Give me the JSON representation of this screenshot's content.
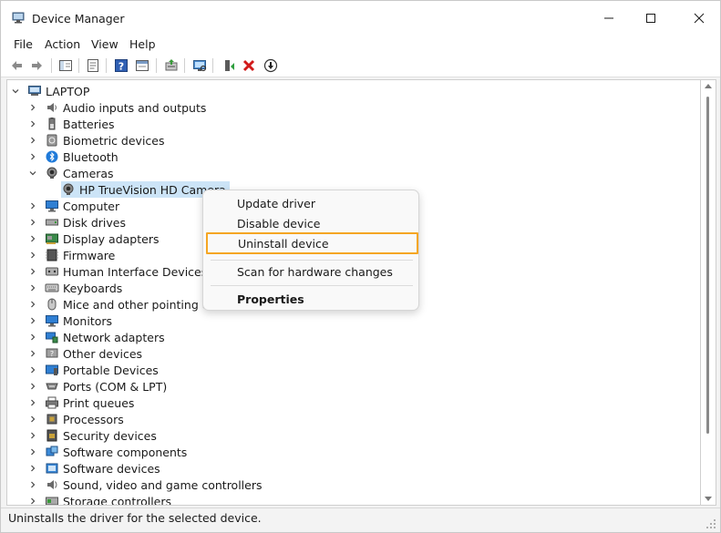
{
  "window": {
    "title": "Device Manager",
    "controls": {
      "minimize": "minimize-icon",
      "maximize": "maximize-icon",
      "close": "close-icon"
    }
  },
  "menubar": {
    "items": [
      "File",
      "Action",
      "View",
      "Help"
    ]
  },
  "toolbar": {
    "icons": [
      "back-arrow-icon",
      "forward-arrow-icon",
      "show-hide-tree-icon",
      "properties-icon",
      "help-icon",
      "view-resources-icon",
      "update-driver-icon",
      "scan-hardware-icon",
      "enable-device-icon",
      "uninstall-device-icon",
      "disable-device-icon"
    ]
  },
  "tree": {
    "root": "LAPTOP",
    "categories": [
      {
        "label": "Audio inputs and outputs",
        "icon": "speaker-icon"
      },
      {
        "label": "Batteries",
        "icon": "battery-icon"
      },
      {
        "label": "Biometric devices",
        "icon": "biometric-icon"
      },
      {
        "label": "Bluetooth",
        "icon": "bluetooth-icon"
      },
      {
        "label": "Cameras",
        "icon": "camera-icon",
        "expanded": true,
        "children": [
          {
            "label": "HP TrueVision HD Camera",
            "icon": "camera-icon",
            "selected": true
          }
        ]
      },
      {
        "label": "Computer",
        "icon": "monitor-icon"
      },
      {
        "label": "Disk drives",
        "icon": "disk-drive-icon"
      },
      {
        "label": "Display adapters",
        "icon": "display-adapter-icon"
      },
      {
        "label": "Firmware",
        "icon": "firmware-icon"
      },
      {
        "label": "Human Interface Devices",
        "icon": "hid-icon"
      },
      {
        "label": "Keyboards",
        "icon": "keyboard-icon"
      },
      {
        "label": "Mice and other pointing dev",
        "icon": "mouse-icon"
      },
      {
        "label": "Monitors",
        "icon": "monitor-icon"
      },
      {
        "label": "Network adapters",
        "icon": "network-adapter-icon"
      },
      {
        "label": "Other devices",
        "icon": "other-devices-icon"
      },
      {
        "label": "Portable Devices",
        "icon": "portable-device-icon"
      },
      {
        "label": "Ports (COM & LPT)",
        "icon": "port-icon"
      },
      {
        "label": "Print queues",
        "icon": "printer-icon"
      },
      {
        "label": "Processors",
        "icon": "processor-icon"
      },
      {
        "label": "Security devices",
        "icon": "security-device-icon"
      },
      {
        "label": "Software components",
        "icon": "software-component-icon"
      },
      {
        "label": "Software devices",
        "icon": "software-device-icon"
      },
      {
        "label": "Sound, video and game controllers",
        "icon": "sound-icon"
      },
      {
        "label": "Storage controllers",
        "icon": "storage-controller-icon"
      }
    ]
  },
  "context_menu": {
    "items": [
      {
        "label": "Update driver"
      },
      {
        "label": "Disable device"
      },
      {
        "label": "Uninstall device",
        "highlighted": true
      },
      {
        "label": "Scan for hardware changes"
      },
      {
        "label": "Properties",
        "bold": true
      }
    ],
    "highlight_color": "#f5a623"
  },
  "statusbar": {
    "text": "Uninstalls the driver for the selected device."
  },
  "colors": {
    "selection": "#cce4f7",
    "accent": "#0067c0"
  }
}
